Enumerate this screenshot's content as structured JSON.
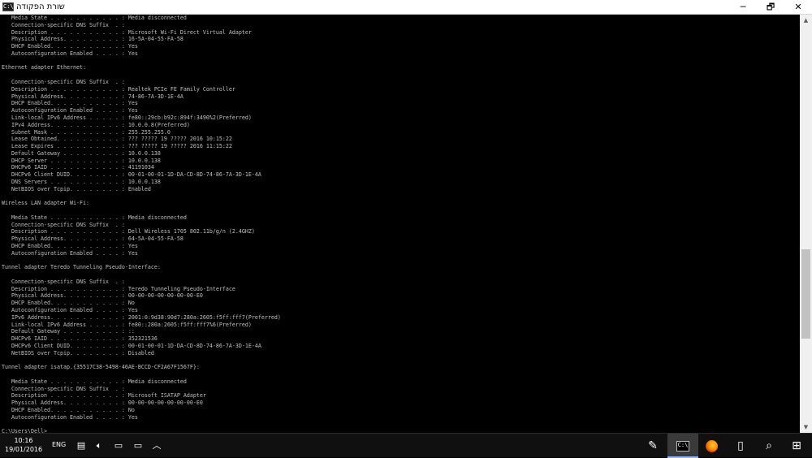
{
  "window": {
    "title": "שורת הפקודה",
    "icon_text": "C:\\"
  },
  "controls": {
    "minimize": "─",
    "maximize": "🗗",
    "close": "✕"
  },
  "console": {
    "lines": [
      "   Media State . . . . . . . . . . . : Media disconnected",
      "   Connection-specific DNS Suffix  . :",
      "   Description . . . . . . . . . . . : Microsoft Wi-Fi Direct Virtual Adapter",
      "   Physical Address. . . . . . . . . : 16-5A-04-55-FA-58",
      "   DHCP Enabled. . . . . . . . . . . : Yes",
      "   Autoconfiguration Enabled . . . . : Yes",
      "",
      "Ethernet adapter Ethernet:",
      "",
      "   Connection-specific DNS Suffix  . :",
      "   Description . . . . . . . . . . . : Realtek PCIe FE Family Controller",
      "   Physical Address. . . . . . . . . : 74-86-7A-3D-1E-4A",
      "   DHCP Enabled. . . . . . . . . . . : Yes",
      "   Autoconfiguration Enabled . . . . : Yes",
      "   Link-local IPv6 Address . . . . . : fe80::29cb:b92c:894f:3490%2(Preferred)",
      "   IPv4 Address. . . . . . . . . . . : 10.0.0.8(Preferred)",
      "   Subnet Mask . . . . . . . . . . . : 255.255.255.0",
      "   Lease Obtained. . . . . . . . . . : ??? ????? 19 ????? 2016 10:15:22",
      "   Lease Expires . . . . . . . . . . : ??? ????? 19 ????? 2016 11:15:22",
      "   Default Gateway . . . . . . . . . : 10.0.0.138",
      "   DHCP Server . . . . . . . . . . . : 10.0.0.138",
      "   DHCPv6 IAID . . . . . . . . . . . : 41191034",
      "   DHCPv6 Client DUID. . . . . . . . : 00-01-00-01-1D-DA-CD-8D-74-86-7A-3D-1E-4A",
      "   DNS Servers . . . . . . . . . . . : 10.0.0.138",
      "   NetBIOS over Tcpip. . . . . . . . : Enabled",
      "",
      "Wireless LAN adapter Wi-Fi:",
      "",
      "   Media State . . . . . . . . . . . : Media disconnected",
      "   Connection-specific DNS Suffix  . :",
      "   Description . . . . . . . . . . . : Dell Wireless 1705 802.11b/g/n (2.4GHZ)",
      "   Physical Address. . . . . . . . . : 64-5A-04-55-FA-58",
      "   DHCP Enabled. . . . . . . . . . . : Yes",
      "   Autoconfiguration Enabled . . . . : Yes",
      "",
      "Tunnel adapter Teredo Tunneling Pseudo-Interface:",
      "",
      "   Connection-specific DNS Suffix  . :",
      "   Description . . . . . . . . . . . : Teredo Tunneling Pseudo-Interface",
      "   Physical Address. . . . . . . . . : 00-00-00-00-00-00-00-E0",
      "   DHCP Enabled. . . . . . . . . . . : No",
      "   Autoconfiguration Enabled . . . . : Yes",
      "   IPv6 Address. . . . . . . . . . . : 2001:0:9d38:90d7:280a:2605:f5ff:fff7(Preferred)",
      "   Link-local IPv6 Address . . . . . : fe80::280a:2605:f5ff:fff7%6(Preferred)",
      "   Default Gateway . . . . . . . . . : ::",
      "   DHCPv6 IAID . . . . . . . . . . . : 352321536",
      "   DHCPv6 Client DUID. . . . . . . . : 00-01-00-01-1D-DA-CD-8D-74-86-7A-3D-1E-4A",
      "   NetBIOS over Tcpip. . . . . . . . : Disabled",
      "",
      "Tunnel adapter isatap.{35517C38-5498-46AE-BCCD-CF2A67F1567F}:",
      "",
      "   Media State . . . . . . . . . . . : Media disconnected",
      "   Connection-specific DNS Suffix  . :",
      "   Description . . . . . . . . . . . : Microsoft ISATAP Adapter",
      "   Physical Address. . . . . . . . . : 00-00-00-00-00-00-00-E0",
      "   DHCP Enabled. . . . . . . . . . . : No",
      "   Autoconfiguration Enabled . . . . : Yes",
      "",
      "C:\\Users\\Dell>"
    ]
  },
  "taskbar": {
    "time": "10:16",
    "date": "19/01/2016",
    "language": "ENG",
    "icons": {
      "notifications": "notification-icon",
      "volume": "volume-icon",
      "network": "network-icon",
      "battery": "battery-icon",
      "show_hidden": "chevron-up-icon",
      "task_view": "task-view-icon",
      "search": "search-icon",
      "start": "windows-start-icon"
    }
  },
  "colors": {
    "console_bg": "#000000",
    "console_text": "#c0c0c0",
    "taskbar_bg": "#101010"
  }
}
